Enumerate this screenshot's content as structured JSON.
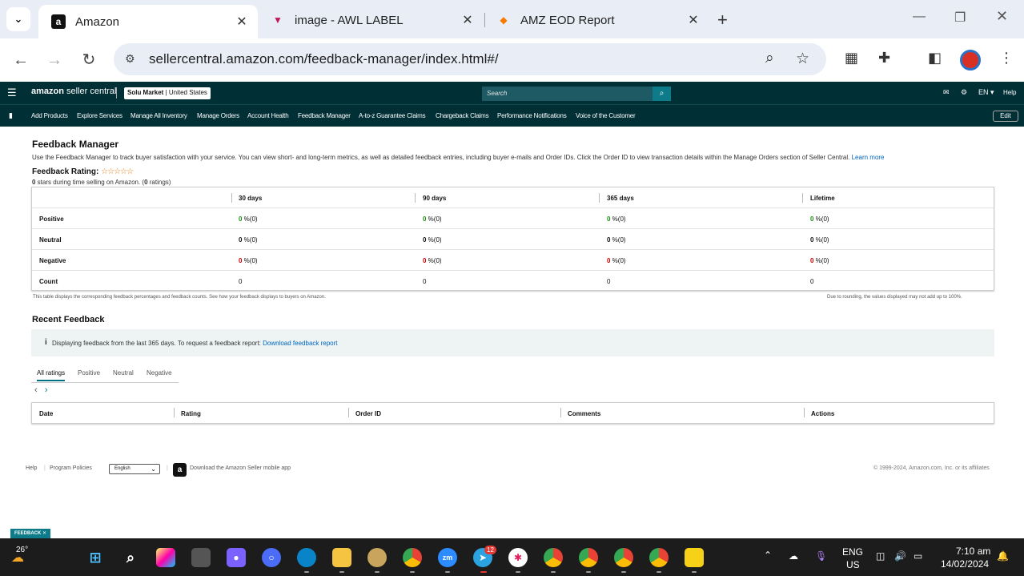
{
  "browser": {
    "tabs": [
      {
        "title": "Amazon",
        "favicon": "amazon-icon"
      },
      {
        "title": "image - AWL LABEL",
        "favicon": "awl-icon"
      },
      {
        "title": "AMZ EOD Report",
        "favicon": "report-icon"
      }
    ],
    "url": "sellercentral.amazon.com/feedback-manager/index.html#/"
  },
  "header": {
    "logo_a": "amazon",
    "logo_b": " seller central",
    "market_name": "Solu Market",
    "market_region": "United States",
    "search_placeholder": "Search",
    "lang": "EN",
    "help": "Help"
  },
  "nav": {
    "items": [
      "Add Products",
      "Explore Services",
      "Manage All Inventory",
      "Manage Orders",
      "Account Health",
      "Feedback Manager",
      "A-to-z Guarantee Claims",
      "Chargeback Claims",
      "Performance Notifications",
      "Voice of the Customer"
    ],
    "edit": "Edit"
  },
  "page": {
    "title": "Feedback Manager",
    "description": "Use the Feedback Manager to track buyer satisfaction with your service. You can view short- and long-term metrics, as well as detailed feedback entries, including buyer e-mails and Order IDs. Click the Order ID to view transaction details within the Manage Orders section of Seller Central.",
    "learn_more": "Learn more",
    "rating_label": "Feedback Rating:",
    "stars": "☆☆☆☆☆",
    "rating_sub_a": "0",
    "rating_sub_b": " stars during time selling on Amazon. (",
    "rating_sub_c": "0",
    "rating_sub_d": " ratings)"
  },
  "summary_table": {
    "columns": [
      "30 days",
      "90 days",
      "365 days",
      "Lifetime"
    ],
    "rows": [
      {
        "label": "Positive",
        "values": [
          {
            "n": "0",
            "s": " %(0)"
          },
          {
            "n": "0",
            "s": " %(0)"
          },
          {
            "n": "0",
            "s": " %(0)"
          },
          {
            "n": "0",
            "s": " %(0)"
          }
        ]
      },
      {
        "label": "Neutral",
        "values": [
          {
            "n": "0",
            "s": " %(0)"
          },
          {
            "n": "0",
            "s": " %(0)"
          },
          {
            "n": "0",
            "s": " %(0)"
          },
          {
            "n": "0",
            "s": " %(0)"
          }
        ]
      },
      {
        "label": "Negative",
        "values": [
          {
            "n": "0",
            "s": " %(0)"
          },
          {
            "n": "0",
            "s": " %(0)"
          },
          {
            "n": "0",
            "s": " %(0)"
          },
          {
            "n": "0",
            "s": " %(0)"
          }
        ]
      },
      {
        "label": "Count",
        "values": [
          {
            "n": "",
            "s": "0"
          },
          {
            "n": "",
            "s": "0"
          },
          {
            "n": "",
            "s": "0"
          },
          {
            "n": "",
            "s": "0"
          }
        ]
      }
    ],
    "note_left": "This table displays the corresponding feedback percentages and feedback counts. See how your feedback displays to buyers on Amazon.",
    "note_right": "Due to rounding, the values displayed may not add up to 100%."
  },
  "recent": {
    "title": "Recent Feedback",
    "info_text": "Displaying feedback from the last 365 days. To request a feedback report:",
    "info_link": "Download feedback report",
    "filter_tabs": [
      "All ratings",
      "Positive",
      "Neutral",
      "Negative"
    ],
    "columns": [
      "Date",
      "Rating",
      "Order ID",
      "Comments",
      "Actions"
    ]
  },
  "footer": {
    "help": "Help",
    "policies": "Program Policies",
    "language": "English",
    "app": "Download the Amazon Seller mobile app",
    "copyright": "© 1999-2024, Amazon.com, Inc. or its affiliates"
  },
  "feedback_badge": "FEEDBACK",
  "taskbar": {
    "weather": "26°",
    "telegram_badge": "12",
    "lang_a": "ENG",
    "lang_b": "US",
    "time": "7:10 am",
    "date": "14/02/2024"
  }
}
